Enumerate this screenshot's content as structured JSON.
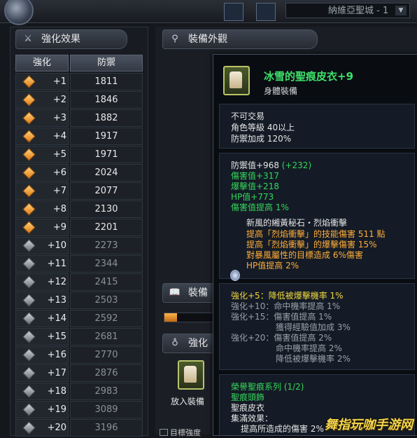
{
  "top_bar": {
    "server_name": "納維亞聖城 - 1",
    "dropdown_arrow": "▼"
  },
  "enhance_panel": {
    "title": "強化效果",
    "title_icon": "sword-icon",
    "col_level": "強化",
    "col_defense": "防禦",
    "rows": [
      {
        "level": "+1",
        "defense": "1811",
        "achieved": true
      },
      {
        "level": "+2",
        "defense": "1846",
        "achieved": true
      },
      {
        "level": "+3",
        "defense": "1882",
        "achieved": true
      },
      {
        "level": "+4",
        "defense": "1917",
        "achieved": true
      },
      {
        "level": "+5",
        "defense": "1971",
        "achieved": true
      },
      {
        "level": "+6",
        "defense": "2024",
        "achieved": true
      },
      {
        "level": "+7",
        "defense": "2077",
        "achieved": true
      },
      {
        "level": "+8",
        "defense": "2130",
        "achieved": true
      },
      {
        "level": "+9",
        "defense": "2201",
        "achieved": true
      },
      {
        "level": "+10",
        "defense": "2273",
        "achieved": false
      },
      {
        "level": "+11",
        "defense": "2344",
        "achieved": false
      },
      {
        "level": "+12",
        "defense": "2415",
        "achieved": false
      },
      {
        "level": "+13",
        "defense": "2503",
        "achieved": false
      },
      {
        "level": "+14",
        "defense": "2592",
        "achieved": false
      },
      {
        "level": "+15",
        "defense": "2681",
        "achieved": false
      },
      {
        "level": "+16",
        "defense": "2770",
        "achieved": false
      },
      {
        "level": "+17",
        "defense": "2876",
        "achieved": false
      },
      {
        "level": "+18",
        "defense": "2983",
        "achieved": false
      },
      {
        "level": "+19",
        "defense": "3089",
        "achieved": false
      },
      {
        "level": "+20",
        "defense": "3196",
        "achieved": false
      }
    ]
  },
  "appearance_panel": {
    "title": "裝備外觀",
    "title_icon": "magnifier-icon"
  },
  "equip_panel": {
    "title": "裝備",
    "title_icon": "book-icon",
    "progress": 0.24
  },
  "enhance2_panel": {
    "title": "強化",
    "title_icon": "bag-icon",
    "put_label": "放入裝備",
    "checkbox_label": "目標強度"
  },
  "tooltip": {
    "name": "冰雪的聖痕皮衣+9",
    "type": "身體裝備",
    "basic": [
      "不可交易",
      "角色等級 40以上",
      "防禦加成 120%"
    ],
    "defense_line": "防禦值+968",
    "defense_bonus": "(+232)",
    "stats": [
      "傷害值+317",
      "爆擊值+218",
      "HP值+773",
      "傷害值提高 1%"
    ],
    "socket_title": "新風的緗黃秘石・烈焰衝擊",
    "socket_lines": [
      "提高「烈焰衝擊」的技能傷害 511 點",
      "提高「烈焰衝擊」的爆擊傷害 15%",
      "對暴風屬性的目標造成 6%傷害",
      "HP值提高 2%"
    ],
    "enh_active": "強化+5：降低被爆擊機率 1%",
    "enh_inactive": [
      "強化+10：命中機率提高 1%",
      "強化+15：傷害值提高 1%",
      "獲得經驗值加成 3%",
      "強化+20：傷害值提高 2%",
      "命中機率提高 2%",
      "降低被爆擊機率 2%"
    ],
    "set_title": "榮譽聖痕系列 (1/2)",
    "set_items": [
      "聖痕頭飾",
      "聖痕皮衣"
    ],
    "set_effect_label": "集滿效果：",
    "set_effect": "提高所造成的傷害 2%"
  },
  "watermark": "舞指玩咖手游网",
  "colors": {
    "achieved_gem": "#e07a14",
    "locked_gem": "#6a7078",
    "item_name": "#3ee06a",
    "stat_green": "#35d65a",
    "socket_orange": "#ffae3a",
    "enh_yellow": "#f0d840"
  }
}
